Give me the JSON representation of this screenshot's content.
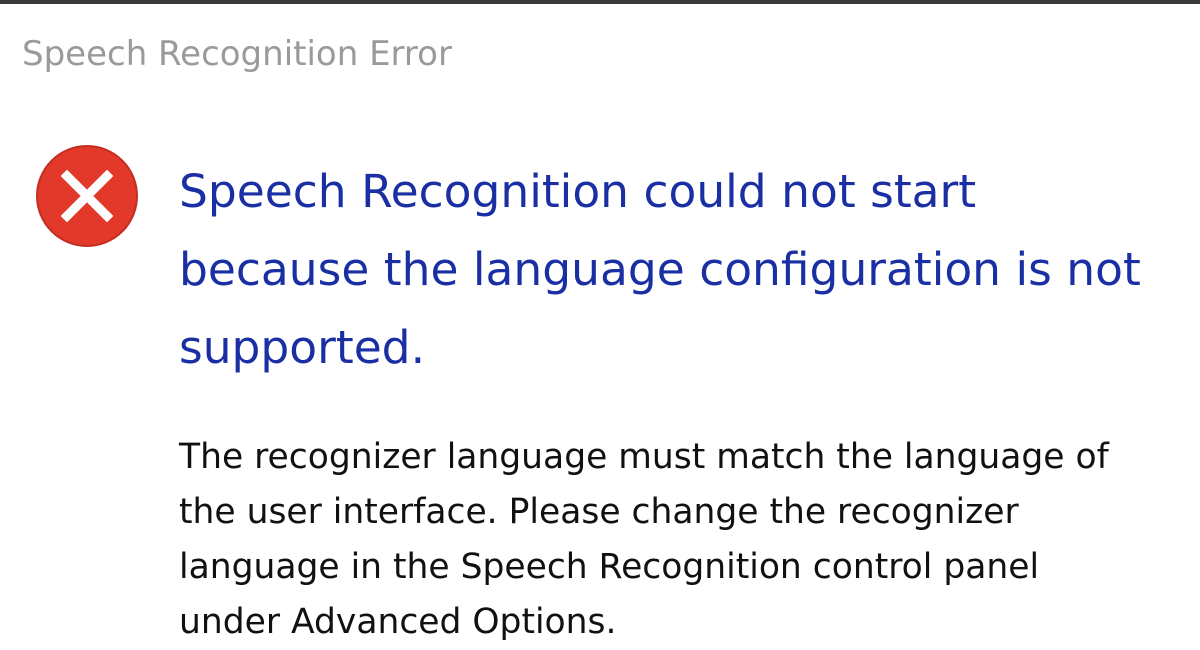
{
  "window": {
    "title": "Speech Recognition Error"
  },
  "dialog": {
    "icon": "error-icon",
    "icon_color": "#e3392a",
    "main_instruction": "Speech Recognition could not start because the language configuration is not supported.",
    "content": "The recognizer language must match the language of\nthe user interface.  Please change the recognizer\nlanguage in the Speech Recognition control panel\nunder Advanced Options."
  },
  "colors": {
    "title_text": "#9a9a9a",
    "instruction_text": "#1a2fa3",
    "body_text": "#111111"
  }
}
